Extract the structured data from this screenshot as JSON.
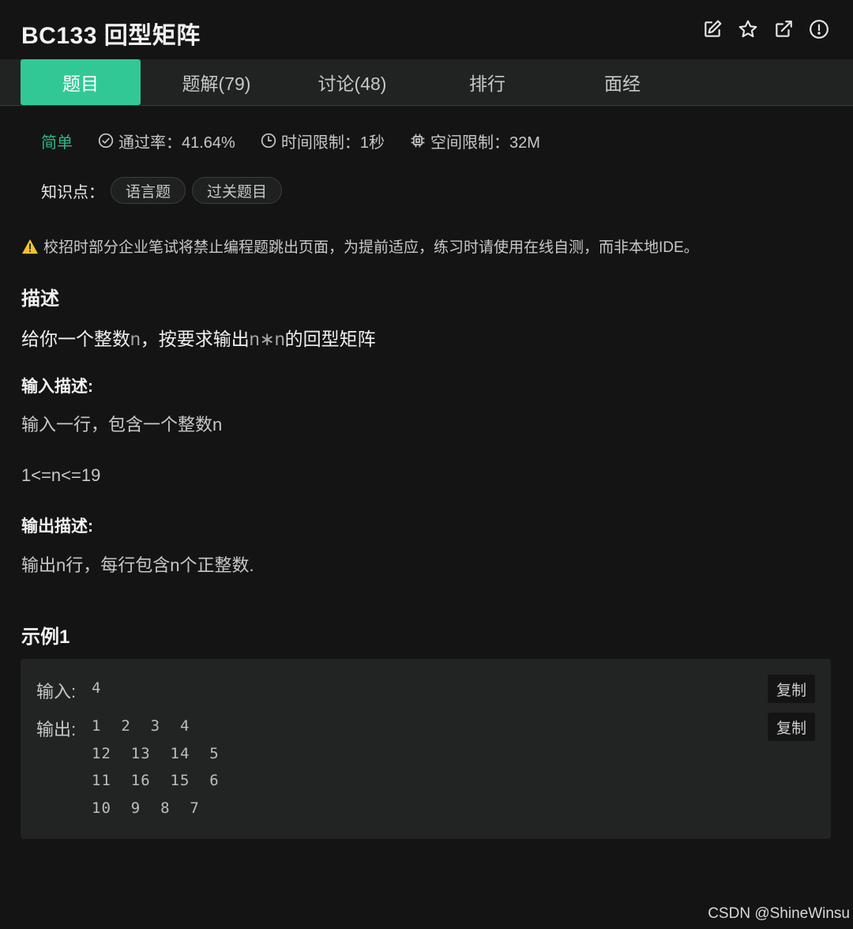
{
  "problem": {
    "title": "BC133  回型矩阵"
  },
  "header_icons": [
    "edit-icon",
    "star-icon",
    "external-link-icon",
    "alert-icon"
  ],
  "tabs": [
    {
      "label": "题目",
      "active": true
    },
    {
      "label": "题解(79)",
      "active": false
    },
    {
      "label": "讨论(48)",
      "active": false
    },
    {
      "label": "排行",
      "active": false
    },
    {
      "label": "面经",
      "active": false
    }
  ],
  "meta": {
    "difficulty": "简单",
    "pass_rate": "通过率：41.64%",
    "time_limit": "时间限制：1秒",
    "space_limit": "空间限制：32M"
  },
  "knowledge": {
    "label": "知识点：",
    "tags": [
      "语言题",
      "过关题目"
    ]
  },
  "notice": "校招时部分企业笔试将禁止编程题跳出页面，为提前适应，练习时请使用在线自测，而非本地IDE。",
  "description": {
    "heading": "描述",
    "text_pre": "给你一个整数",
    "text_var": "n",
    "text_mid": "，按要求输出",
    "text_expr": "n∗n",
    "text_post": "的回型矩阵"
  },
  "input_desc": {
    "heading": "输入描述:",
    "line1": "输入一行，包含一个整数n",
    "line2": "1<=n<=19"
  },
  "output_desc": {
    "heading": "输出描述:",
    "line1": "输出n行，每行包含n个正整数."
  },
  "example": {
    "heading": "示例1",
    "input_label": "输入:",
    "input_value": "4",
    "output_label": "输出:",
    "output_lines": [
      "1 2 3 4",
      "12 13 14 5",
      "11 16 15 6",
      "10 9 8 7"
    ],
    "copy_label": "复制"
  },
  "watermark": "CSDN @ShineWinsu",
  "colors": {
    "accent": "#32c896",
    "background": "#141414",
    "panel": "#222323"
  }
}
